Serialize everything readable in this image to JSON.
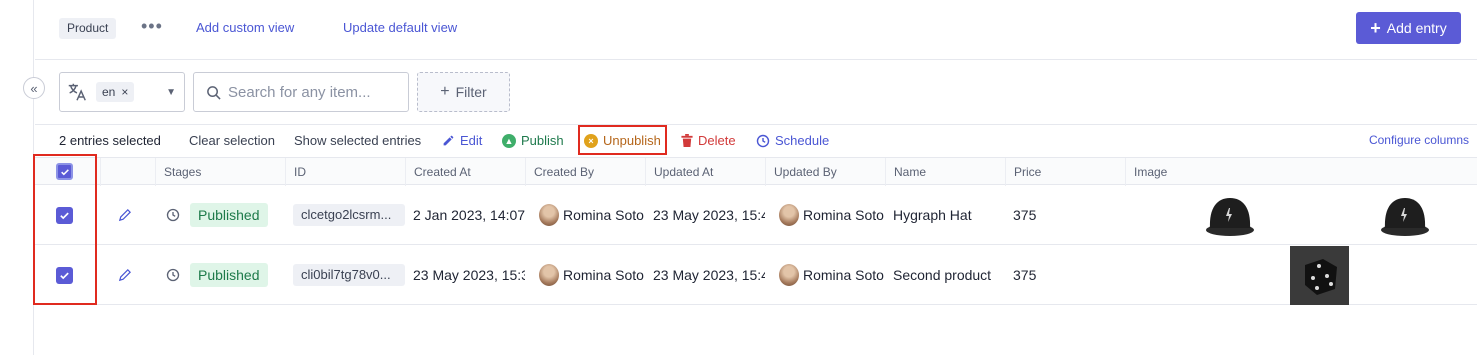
{
  "topbar": {
    "view_chip": "Product",
    "more_label": "•••",
    "add_custom_view": "Add custom view",
    "update_default_view": "Update default view",
    "add_entry": "Add entry"
  },
  "filterbar": {
    "locale_tag": "en",
    "locale_remove": "×",
    "search_placeholder": "Search for any item...",
    "filter_label": "Filter"
  },
  "actionbar": {
    "selected_count": "2 entries selected",
    "clear_selection": "Clear selection",
    "show_selected": "Show selected entries",
    "edit": "Edit",
    "publish": "Publish",
    "unpublish": "Unpublish",
    "delete": "Delete",
    "schedule": "Schedule",
    "configure_columns": "Configure columns"
  },
  "table": {
    "headers": [
      "Stages",
      "ID",
      "Created At",
      "Created By",
      "Updated At",
      "Updated By",
      "Name",
      "Price",
      "Image"
    ],
    "rows": [
      {
        "selected": true,
        "stage": "Published",
        "id": "clcetgo2lcsrm...",
        "created_at": "2 Jan 2023, 14:07",
        "created_by": "Romina Soto",
        "updated_at": "23 May 2023, 15:4",
        "updated_by": "Romina Soto",
        "name": "Hygraph Hat",
        "price": "375",
        "images": [
          "cap-image",
          "cap-image"
        ]
      },
      {
        "selected": true,
        "stage": "Published",
        "id": "cli0bil7tg78v0...",
        "created_at": "23 May 2023, 15:3",
        "created_by": "Romina Soto",
        "updated_at": "23 May 2023, 15:4",
        "updated_by": "Romina Soto",
        "name": "Second product",
        "price": "375",
        "images": [
          "dice-image"
        ]
      }
    ]
  },
  "colors": {
    "accent": "#5b5bd6",
    "link": "#4a56d4",
    "published_bg": "#dff5e8",
    "published_text": "#1d7a4a",
    "highlight": "#e02a1f",
    "delete": "#d23a3a"
  }
}
